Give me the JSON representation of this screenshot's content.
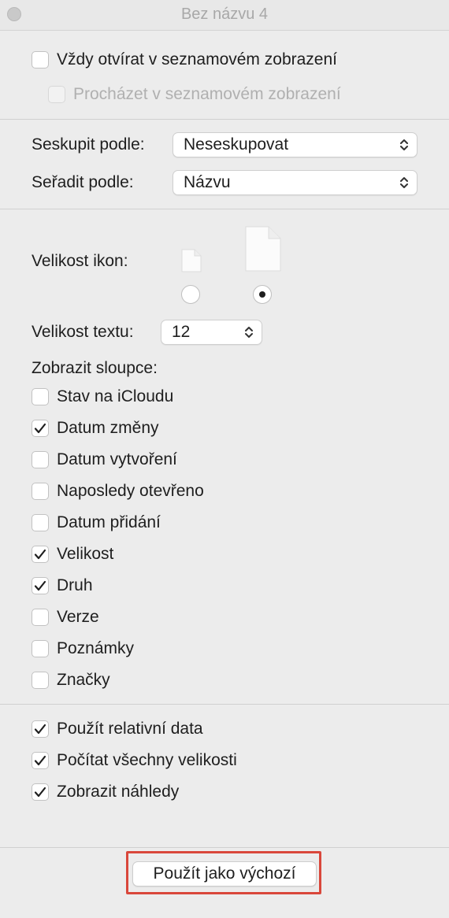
{
  "window": {
    "title": "Bez názvu 4"
  },
  "options": {
    "always_list": {
      "label": "Vždy otvírat v seznamovém zobrazení",
      "checked": false
    },
    "browse_list": {
      "label": "Procházet v seznamovém zobrazení",
      "checked": false,
      "disabled": true
    }
  },
  "group_by": {
    "label": "Seskupit podle:",
    "value": "Neseskupovat"
  },
  "sort_by": {
    "label": "Seřadit podle:",
    "value": "Názvu"
  },
  "icon_size": {
    "label": "Velikost ikon:",
    "selected": "large"
  },
  "text_size": {
    "label": "Velikost textu:",
    "value": "12"
  },
  "columns": {
    "label": "Zobrazit sloupce:",
    "items": [
      {
        "label": "Stav na iCloudu",
        "checked": false
      },
      {
        "label": "Datum změny",
        "checked": true
      },
      {
        "label": "Datum vytvoření",
        "checked": false
      },
      {
        "label": "Naposledy otevřeno",
        "checked": false
      },
      {
        "label": "Datum přidání",
        "checked": false
      },
      {
        "label": "Velikost",
        "checked": true
      },
      {
        "label": "Druh",
        "checked": true
      },
      {
        "label": "Verze",
        "checked": false
      },
      {
        "label": "Poznámky",
        "checked": false
      },
      {
        "label": "Značky",
        "checked": false
      }
    ]
  },
  "extras": {
    "items": [
      {
        "label": "Použít relativní data",
        "checked": true
      },
      {
        "label": "Počítat všechny velikosti",
        "checked": true
      },
      {
        "label": "Zobrazit náhledy",
        "checked": true
      }
    ]
  },
  "footer": {
    "default_button": "Použít jako výchozí"
  },
  "colors": {
    "highlight": "#d9473b",
    "background": "#ececec"
  }
}
